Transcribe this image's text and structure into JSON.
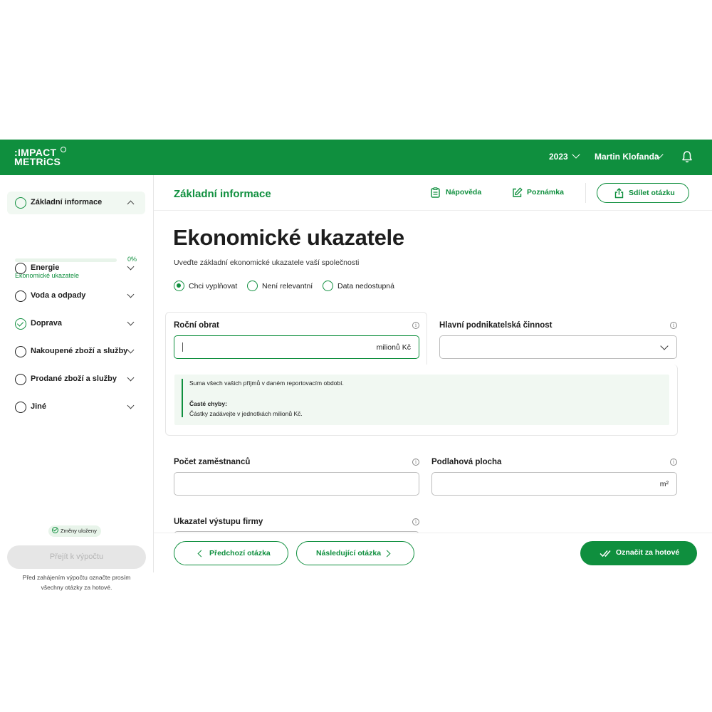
{
  "brand": {
    "line1": ":IMPACT",
    "line2": "METRiCS",
    "badge_icon": "registered-ring-icon"
  },
  "topbar": {
    "year": "2023",
    "user": "Martin Klofanda",
    "notifications_icon": "bell-icon"
  },
  "sidebar": {
    "sections": [
      {
        "label": "Základní informace",
        "state": "open",
        "active": true
      },
      {
        "label": "Energie",
        "state": "closed"
      },
      {
        "label": "Voda a odpady",
        "state": "closed"
      },
      {
        "label": "Doprava",
        "state": "closed",
        "completed": true
      },
      {
        "label": "Nakoupené zboží a služby",
        "state": "closed"
      },
      {
        "label": "Prodané zboží a služby",
        "state": "closed"
      },
      {
        "label": "Jiné",
        "state": "closed"
      }
    ],
    "progress": {
      "value": 0,
      "label": "0%"
    },
    "sub_item": "Ekonomické ukazatele",
    "saved_status": "Změny uloženy",
    "calc_button": "Přejít k výpočtu",
    "calc_note_line1": "Před zahájením výpočtu označte prosím",
    "calc_note_line2": "všechny otázky za hotové."
  },
  "header": {
    "section_title": "Základní informace",
    "help": "Nápověda",
    "note": "Poznámka",
    "share": "Sdílet otázku"
  },
  "question": {
    "title": "Ekonomické ukazatele",
    "subtitle": "Uveďte základní ekonomické ukazatele vaší společnosti",
    "options": [
      {
        "label": "Chci vyplňovat",
        "selected": true
      },
      {
        "label": "Není relevantní",
        "selected": false
      },
      {
        "label": "Data nedostupná",
        "selected": false
      }
    ]
  },
  "fields": {
    "revenue": {
      "label": "Roční obrat",
      "value": "",
      "suffix": "milionů Kč"
    },
    "activity": {
      "label": "Hlavní podnikatelská činnost",
      "value": ""
    },
    "employees": {
      "label": "Počet zaměstnanců",
      "value": ""
    },
    "floor_area": {
      "label": "Podlahová plocha",
      "value": "",
      "suffix": "m²"
    },
    "output": {
      "label": "Ukazatel výstupu firmy"
    }
  },
  "help_box": {
    "description": "Suma všech vašich příjmů v daném reportovacím období.",
    "mistakes_title": "Časté chyby:",
    "mistakes_text": "Částky zadávejte v jednotkách milionů Kč."
  },
  "footer": {
    "prev": "Předchozí otázka",
    "next": "Následující otázka",
    "done": "Označit za hotové"
  },
  "colors": {
    "accent": "#0f8f3e",
    "accent_light": "#f1f8f2",
    "text": "#1d1d1d"
  }
}
